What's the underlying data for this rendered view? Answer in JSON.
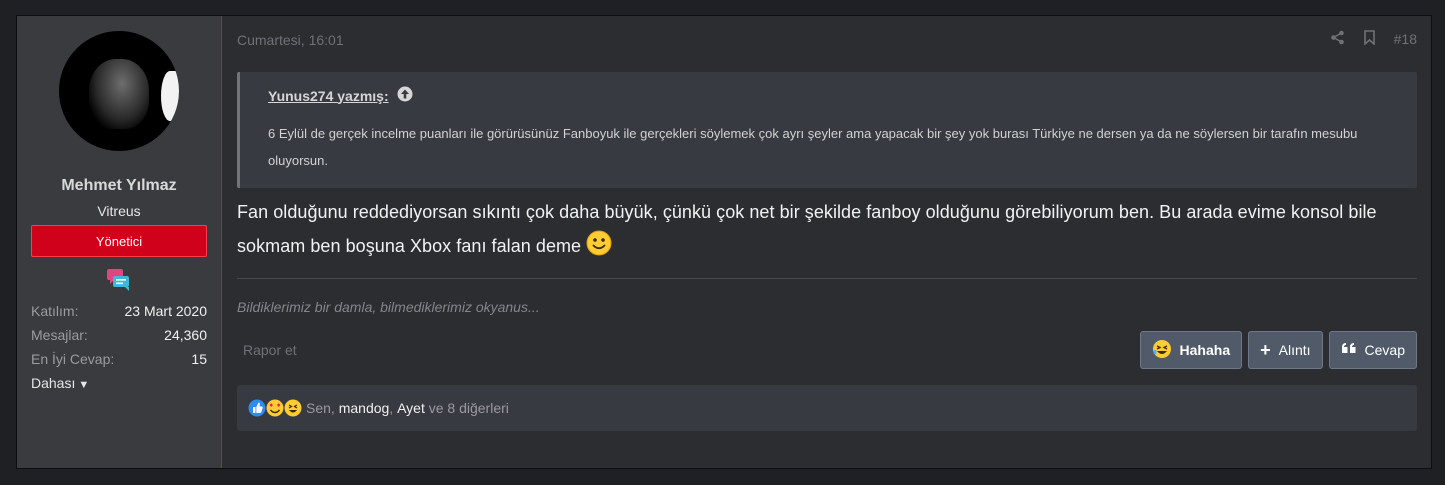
{
  "user": {
    "name": "Mehmet Yılmaz",
    "title": "Vitreus",
    "banner": "Yönetici",
    "stats": [
      {
        "label": "Katılım:",
        "value": "23 Mart 2020"
      },
      {
        "label": "Mesajlar:",
        "value": "24,360"
      },
      {
        "label": "En İyi Cevap:",
        "value": "15"
      }
    ],
    "more_label": "Dahası"
  },
  "post": {
    "date": "Cumartesi, 16:01",
    "number": "#18",
    "quote": {
      "author_label": "Yunus274 yazmış:",
      "text": "6 Eylül de gerçek incelme puanları ile görürüsünüz Fanboyuk ile gerçekleri söylemek çok ayrı şeyler ama yapacak bir şey yok burası Türkiye ne dersen ya da ne söylersen bir tarafın mesubu oluyorsun."
    },
    "body": "Fan olduğunu reddediyorsan sıkıntı çok daha büyük, çünkü çok net bir şekilde fanboy olduğunu görebiliyorum ben. Bu arada evime konsol bile sokmam ben boşuna Xbox fanı falan deme",
    "signature": "Bildiklerimiz bir damla, bilmediklerimiz okyanus...",
    "report_label": "Rapor et",
    "buttons": {
      "hahaha": "Hahaha",
      "quote": "Alıntı",
      "reply": "Cevap"
    },
    "reactions": {
      "you": "Sen,",
      "user1": "mandog",
      "sep": ",",
      "user2": "Ayet",
      "others": "ve 8 diğerleri"
    }
  },
  "colors": {
    "banner": "#d0021b",
    "user_border": "#2a5f7a",
    "button_bg": "#505a69"
  },
  "icons": [
    "share-icon",
    "bookmark-icon",
    "arrow-up-circle-icon",
    "chat-bubbles-icon",
    "laughing-emoji-icon",
    "plus-icon",
    "quote-marks-icon",
    "like-reaction-icon",
    "love-reaction-icon",
    "smiley-icon",
    "caret-down-icon"
  ]
}
